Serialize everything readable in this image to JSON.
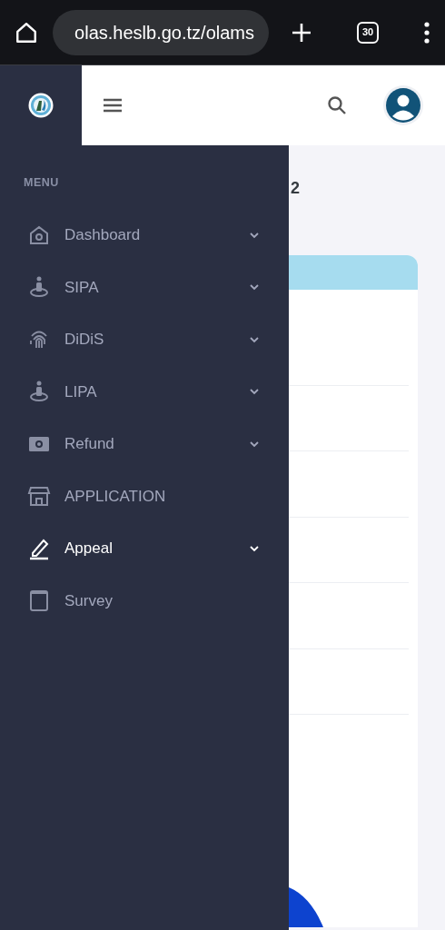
{
  "browser": {
    "url": "olas.heslb.go.tz/olams",
    "tab_count": "30"
  },
  "content": {
    "heading_fragment": "2"
  },
  "sidebar": {
    "section_label": "MENU",
    "items": [
      {
        "label": "Dashboard",
        "has_submenu": true,
        "selected": false
      },
      {
        "label": "SIPA",
        "has_submenu": true,
        "selected": false
      },
      {
        "label": "DiDiS",
        "has_submenu": true,
        "selected": false
      },
      {
        "label": "LIPA",
        "has_submenu": true,
        "selected": false
      },
      {
        "label": "Refund",
        "has_submenu": true,
        "selected": false
      },
      {
        "label": "APPLICATION",
        "has_submenu": false,
        "selected": false
      },
      {
        "label": "Appeal",
        "has_submenu": true,
        "selected": true
      },
      {
        "label": "Survey",
        "has_submenu": false,
        "selected": false
      }
    ]
  }
}
